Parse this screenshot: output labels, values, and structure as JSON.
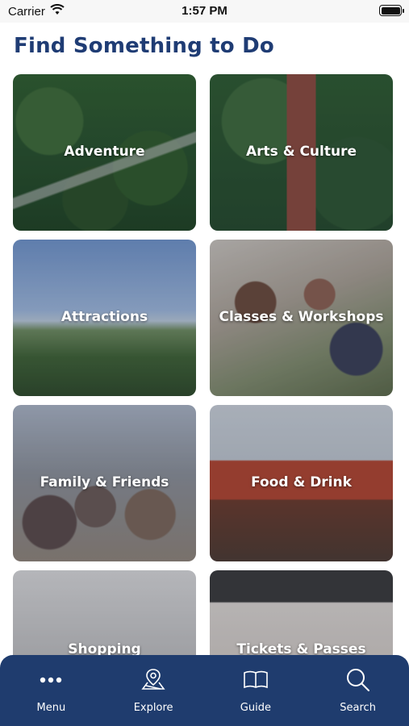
{
  "status_bar": {
    "carrier": "Carrier",
    "time": "1:57 PM",
    "icons": [
      "wifi-icon",
      "battery-icon"
    ]
  },
  "page": {
    "title": "Find Something to Do",
    "title_color": "#1f3c74"
  },
  "categories": [
    {
      "label": "Adventure"
    },
    {
      "label": "Arts & Culture"
    },
    {
      "label": "Attractions"
    },
    {
      "label": "Classes & Workshops"
    },
    {
      "label": "Family & Friends"
    },
    {
      "label": "Food & Drink"
    },
    {
      "label": "Shopping"
    },
    {
      "label": "Tickets & Passes"
    }
  ],
  "tab_bar": {
    "background": "#1f3c6e",
    "items": [
      {
        "label": "Menu",
        "icon": "more-dots-icon"
      },
      {
        "label": "Explore",
        "icon": "map-pin-icon"
      },
      {
        "label": "Guide",
        "icon": "book-icon"
      },
      {
        "label": "Search",
        "icon": "search-icon"
      }
    ]
  }
}
